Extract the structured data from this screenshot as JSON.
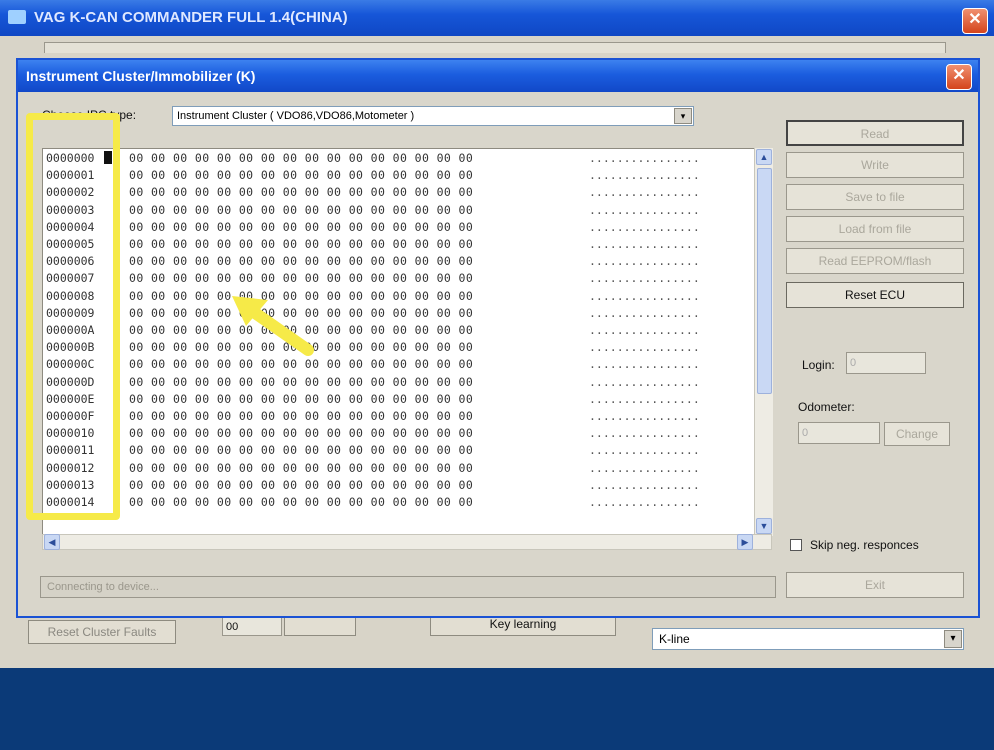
{
  "main_window": {
    "title": "VAG K-CAN COMMANDER FULL 1.4(CHINA)",
    "close_glyph": "✕",
    "bottom_buttons": [
      "Reset Cluster Faults",
      "Key learning"
    ],
    "small_field_value": "00",
    "connection": {
      "selected": "K-line",
      "dropdown_glyph": "▾"
    }
  },
  "dialog": {
    "title": "Instrument Cluster/Immobilizer (K)",
    "close_glyph": "✕",
    "ipc_type": {
      "label": "Choose IPC type:",
      "selected": "Instrument Cluster ( VDO86,VDO86,Motometer )",
      "dropdown_glyph": "▾"
    },
    "hex_rows": [
      {
        "addr": "0000000",
        "bytes": "00 00 00 00 00 00 00 00 00 00 00 00 00 00 00 00",
        "ascii": "................"
      },
      {
        "addr": "0000001",
        "bytes": "00 00 00 00 00 00 00 00 00 00 00 00 00 00 00 00",
        "ascii": "................"
      },
      {
        "addr": "0000002",
        "bytes": "00 00 00 00 00 00 00 00 00 00 00 00 00 00 00 00",
        "ascii": "................"
      },
      {
        "addr": "0000003",
        "bytes": "00 00 00 00 00 00 00 00 00 00 00 00 00 00 00 00",
        "ascii": "................"
      },
      {
        "addr": "0000004",
        "bytes": "00 00 00 00 00 00 00 00 00 00 00 00 00 00 00 00",
        "ascii": "................"
      },
      {
        "addr": "0000005",
        "bytes": "00 00 00 00 00 00 00 00 00 00 00 00 00 00 00 00",
        "ascii": "................"
      },
      {
        "addr": "0000006",
        "bytes": "00 00 00 00 00 00 00 00 00 00 00 00 00 00 00 00",
        "ascii": "................"
      },
      {
        "addr": "0000007",
        "bytes": "00 00 00 00 00 00 00 00 00 00 00 00 00 00 00 00",
        "ascii": "................"
      },
      {
        "addr": "0000008",
        "bytes": "00 00 00 00 00 00 00 00 00 00 00 00 00 00 00 00",
        "ascii": "................"
      },
      {
        "addr": "0000009",
        "bytes": "00 00 00 00 00 00 00 00 00 00 00 00 00 00 00 00",
        "ascii": "................"
      },
      {
        "addr": "000000A",
        "bytes": "00 00 00 00 00 00 00 00 00 00 00 00 00 00 00 00",
        "ascii": "................"
      },
      {
        "addr": "000000B",
        "bytes": "00 00 00 00 00 00 00 00 00 00 00 00 00 00 00 00",
        "ascii": "................"
      },
      {
        "addr": "000000C",
        "bytes": "00 00 00 00 00 00 00 00 00 00 00 00 00 00 00 00",
        "ascii": "................"
      },
      {
        "addr": "000000D",
        "bytes": "00 00 00 00 00 00 00 00 00 00 00 00 00 00 00 00",
        "ascii": "................"
      },
      {
        "addr": "000000E",
        "bytes": "00 00 00 00 00 00 00 00 00 00 00 00 00 00 00 00",
        "ascii": "................"
      },
      {
        "addr": "000000F",
        "bytes": "00 00 00 00 00 00 00 00 00 00 00 00 00 00 00 00",
        "ascii": "................"
      },
      {
        "addr": "0000010",
        "bytes": "00 00 00 00 00 00 00 00 00 00 00 00 00 00 00 00",
        "ascii": "................"
      },
      {
        "addr": "0000011",
        "bytes": "00 00 00 00 00 00 00 00 00 00 00 00 00 00 00 00",
        "ascii": "................"
      },
      {
        "addr": "0000012",
        "bytes": "00 00 00 00 00 00 00 00 00 00 00 00 00 00 00 00",
        "ascii": "................"
      },
      {
        "addr": "0000013",
        "bytes": "00 00 00 00 00 00 00 00 00 00 00 00 00 00 00 00",
        "ascii": "................"
      },
      {
        "addr": "0000014",
        "bytes": "00 00 00 00 00 00 00 00 00 00 00 00 00 00 00 00",
        "ascii": "................"
      }
    ],
    "scroll_glyphs": {
      "up": "▲",
      "down": "▼",
      "left": "◀",
      "right": "▶"
    },
    "status_text": "Connecting to device...",
    "buttons": {
      "read": "Read",
      "write": "Write",
      "save_to_file": "Save to file",
      "load_from_file": "Load from file",
      "read_eeprom_flash": "Read EEPROM/flash",
      "reset_ecu": "Reset ECU",
      "change": "Change",
      "exit": "Exit"
    },
    "login": {
      "label": "Login:",
      "value": "0"
    },
    "odometer": {
      "label": "Odometer:",
      "value": "0"
    },
    "skip_neg": {
      "label": "Skip neg. responces",
      "checked": false
    }
  },
  "overlay": {
    "highlight_color": "#f6ea48",
    "arrow_color": "#f6ea48",
    "arrow_icon": "arrow-pointer-icon"
  }
}
